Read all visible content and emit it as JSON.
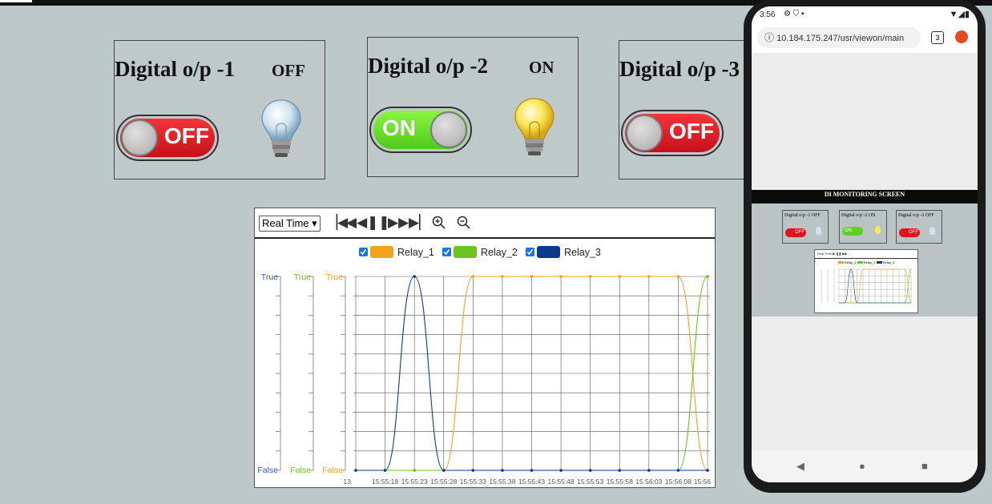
{
  "panels": [
    {
      "title": "Digital o/p -1",
      "state": "OFF",
      "toggle": "OFF",
      "bulb": "off"
    },
    {
      "title": "Digital o/p -2",
      "state": "ON",
      "toggle": "ON",
      "bulb": "on"
    },
    {
      "title": "Digital o/p -3",
      "state": "",
      "toggle": "OFF",
      "bulb": "off"
    }
  ],
  "toolbar": {
    "mode": "Real Time",
    "icons": [
      "skip-to-start-icon",
      "rewind-icon",
      "pause-icon",
      "fast-forward-icon",
      "skip-to-end-icon",
      "zoom-in-icon",
      "zoom-out-icon"
    ]
  },
  "colors": {
    "relay1": "#f2a21b",
    "relay2": "#6cc51e",
    "relay3": "#0b3a8c",
    "on_green": "#5fd21e",
    "off_red": "#e3131d",
    "background": "#bdc8c8"
  },
  "chart_data": {
    "type": "line",
    "legend": [
      "Relay_1",
      "Relay_2",
      "Relay_3"
    ],
    "x": [
      "13",
      "15:55:18",
      "15:55:23",
      "15:55:28",
      "15:55:33",
      "15:55:38",
      "15:55:43",
      "15:55:48",
      "15:55:53",
      "15:55:58",
      "15:56:03",
      "15:56:08",
      "15:56"
    ],
    "axes": [
      {
        "top": "True",
        "bottom": "False",
        "color": "#2f5ca8"
      },
      {
        "top": "True",
        "bottom": "False",
        "color": "#6cc51e"
      },
      {
        "top": "True",
        "bottom": "False",
        "color": "#f2a21b"
      }
    ],
    "series": [
      {
        "name": "Relay_1",
        "color": "#f2a21b",
        "values": [
          0,
          0,
          0,
          0,
          1,
          1,
          1,
          1,
          1,
          1,
          1,
          1,
          0
        ]
      },
      {
        "name": "Relay_2",
        "color": "#6cc51e",
        "values": [
          0,
          0,
          0,
          0,
          0,
          0,
          0,
          0,
          0,
          0,
          0,
          0,
          1
        ]
      },
      {
        "name": "Relay_3",
        "color": "#0b3a8c",
        "values": [
          0,
          0,
          1,
          0,
          0,
          0,
          0,
          0,
          0,
          0,
          0,
          0,
          0
        ]
      }
    ],
    "grid": true,
    "legend_position": "top"
  },
  "phone": {
    "time": "3:56",
    "url": "10.184.175.247/usr/viewon/main",
    "tab_count": "3",
    "screen_title": "DI MONITORING SCREEN",
    "mini_panels": [
      {
        "title": "Digital o/p -1",
        "state": "OFF",
        "toggle": "OFF"
      },
      {
        "title": "Digital o/p -2",
        "state": "ON",
        "toggle": "ON"
      },
      {
        "title": "Digital o/p -3",
        "state": "OFF",
        "toggle": "OFF"
      }
    ],
    "mini_legend": [
      "Relay_1",
      "Relay_2",
      "Relay_3"
    ]
  }
}
